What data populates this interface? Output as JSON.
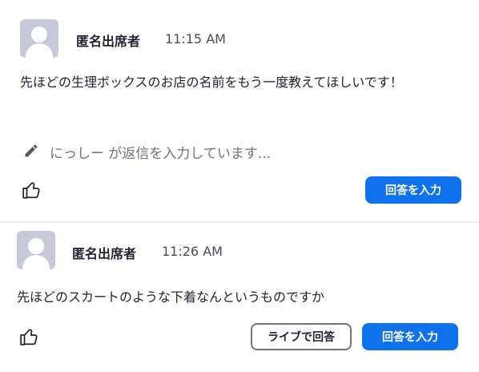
{
  "colors": {
    "primary": "#0e72ed",
    "avatar_bg": "#c7c9d9",
    "text": "#232333",
    "muted": "#6e7680"
  },
  "questions": [
    {
      "author": "匿名出席者",
      "time": "11:15 AM",
      "text": "先ほどの生理ボックスのお店の名前をもう一度教えてほしいです！",
      "typing_indicator": "にっしー が返信を入力しています...",
      "like_icon": "thumbs-up-icon",
      "answer_button": "回答を入力"
    },
    {
      "author": "匿名出席者",
      "time": "11:26 AM",
      "text": "先ほどのスカートのような下着なんというものですか",
      "like_icon": "thumbs-up-icon",
      "live_answer_button": "ライブで回答",
      "answer_button": "回答を入力"
    }
  ]
}
